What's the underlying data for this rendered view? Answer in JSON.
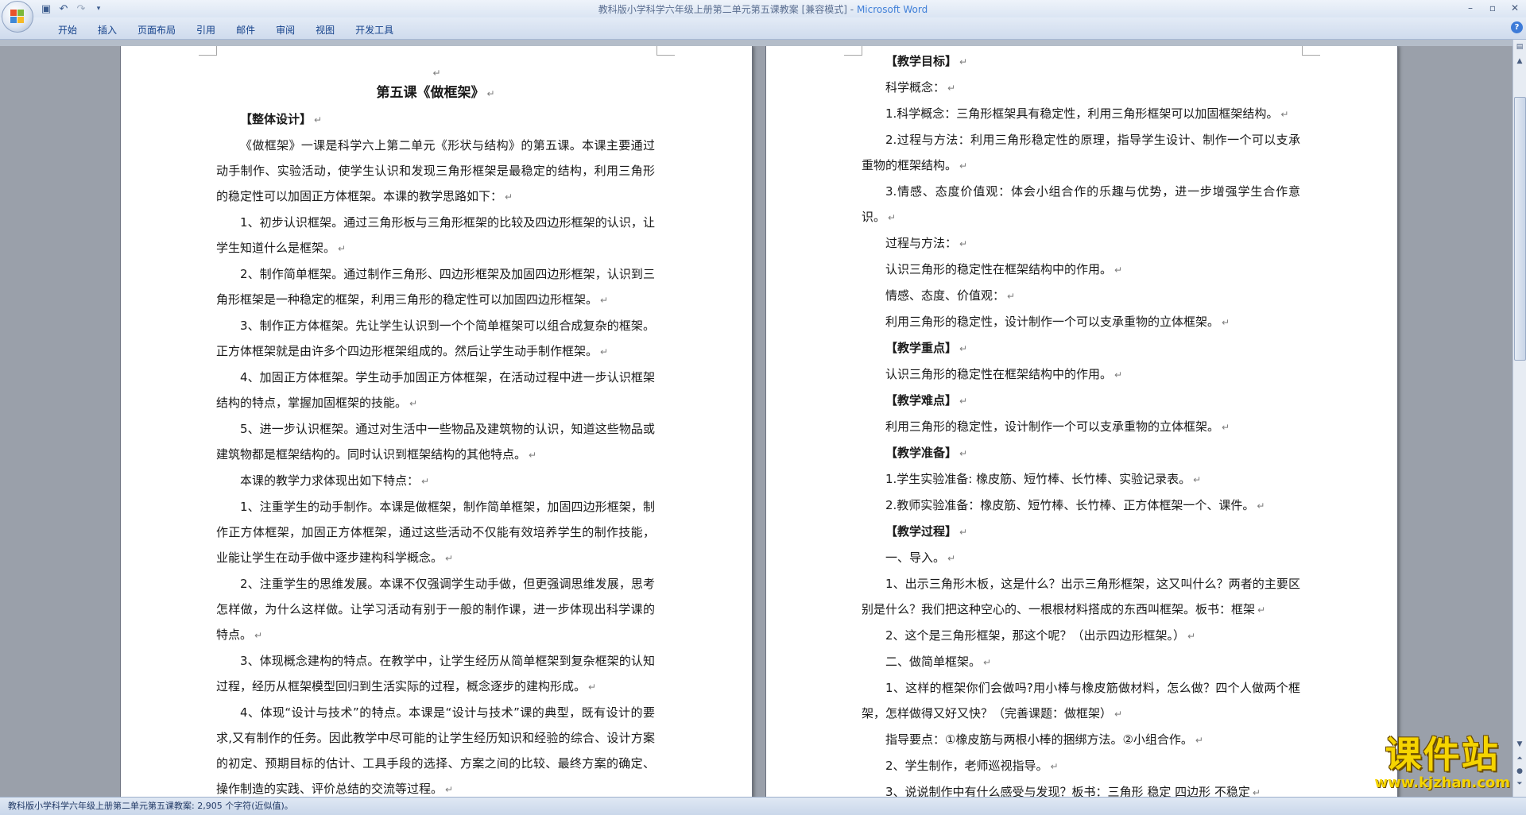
{
  "titlebar": {
    "doc_title": "教科版小学科学六年级上册第二单元第五课教案 [兼容模式]",
    "separator": " - ",
    "app_name": "Microsoft Word"
  },
  "ribbon": {
    "tabs": [
      "开始",
      "插入",
      "页面布局",
      "引用",
      "邮件",
      "审阅",
      "视图",
      "开发工具"
    ]
  },
  "mark": "↵",
  "left_page": {
    "title": "第五课《做框架》",
    "paragraphs": [
      "【整体设计】",
      "《做框架》一课是科学六上第二单元《形状与结构》的第五课。本课主要通过动手制作、实验活动，使学生认识和发现三角形框架是最稳定的结构，利用三角形的稳定性可以加固正方体框架。本课的教学思路如下：",
      "1、初步认识框架。通过三角形板与三角形框架的比较及四边形框架的认识，让学生知道什么是框架。",
      "2、制作简单框架。通过制作三角形、四边形框架及加固四边形框架，认识到三角形框架是一种稳定的框架，利用三角形的稳定性可以加固四边形框架。",
      "3、制作正方体框架。先让学生认识到一个个简单框架可以组合成复杂的框架。正方体框架就是由许多个四边形框架组成的。然后让学生动手制作框架。",
      "4、加固正方体框架。学生动手加固正方体框架，在活动过程中进一步认识框架结构的特点，掌握加固框架的技能。",
      "5、进一步认识框架。通过对生活中一些物品及建筑物的认识，知道这些物品或建筑物都是框架结构的。同时认识到框架结构的其他特点。",
      "本课的教学力求体现出如下特点：",
      "1、注重学生的动手制作。本课是做框架，制作简单框架，加固四边形框架，制作正方体框架，加固正方体框架，通过这些活动不仅能有效培养学生的制作技能，业能让学生在动手做中逐步建构科学概念。",
      "2、注重学生的思维发展。本课不仅强调学生动手做，但更强调思维发展，思考怎样做，为什么这样做。让学习活动有别于一般的制作课，进一步体现出科学课的特点。",
      "3、体现概念建构的特点。在教学中，让学生经历从简单框架到复杂框架的认知过程，经历从框架模型回归到生活实际的过程，概念逐步的建构形成。",
      "4、体现“设计与技术”的特点。本课是“设计与技术”课的典型，既有设计的要求,又有制作的任务。因此教学中尽可能的让学生经历知识和经验的综合、设计方案的初定、预期目标的估计、工具手段的选择、方案之间的比较、最终方案的确定、操作制造的实践、评价总结的交流等过程。"
    ]
  },
  "right_page": {
    "paragraphs": [
      "【教学目标】",
      "科学概念：",
      "1.科学概念：三角形框架具有稳定性，利用三角形框架可以加固框架结构。",
      "2.过程与方法：利用三角形稳定性的原理，指导学生设计、制作一个可以支承重物的框架结构。",
      "3.情感、态度价值观：体会小组合作的乐趣与优势，进一步增强学生合作意识。",
      "过程与方法：",
      "认识三角形的稳定性在框架结构中的作用。",
      "情感、态度、价值观：",
      "利用三角形的稳定性，设计制作一个可以支承重物的立体框架。",
      "【教学重点】",
      "认识三角形的稳定性在框架结构中的作用。",
      "【教学难点】",
      "利用三角形的稳定性，设计制作一个可以支承重物的立体框架。",
      "【教学准备】",
      "1.学生实验准备: 橡皮筋、短竹棒、长竹棒、实验记录表。",
      "2.教师实验准备：橡皮筋、短竹棒、长竹棒、正方体框架一个、课件。",
      "【教学过程】",
      "一、导入。",
      "1、出示三角形木板，这是什么？出示三角形框架，这又叫什么？两者的主要区别是什么？我们把这种空心的、一根根材料搭成的东西叫框架。板书：框架",
      "2、这个是三角形框架，那这个呢？（出示四边形框架。）",
      "二、做简单框架。",
      "1、这样的框架你们会做吗?用小棒与橡皮筋做材料，怎么做？四个人做两个框架，怎样做得又好又快？（完善课题：做框架）",
      "指导要点：①橡皮筋与两根小棒的捆绑方法。②小组合作。",
      "2、学生制作，老师巡视指导。",
      "3、说说制作中有什么感受与发现？板书：三角形 稳定  四边形 不稳定"
    ]
  },
  "statusbar": {
    "text": "教科版小学科学六年级上册第二单元第五课教案: 2,905 个字符(近似值)。"
  },
  "watermark": {
    "title": "课件站",
    "url": "www.kjzhan.com"
  }
}
